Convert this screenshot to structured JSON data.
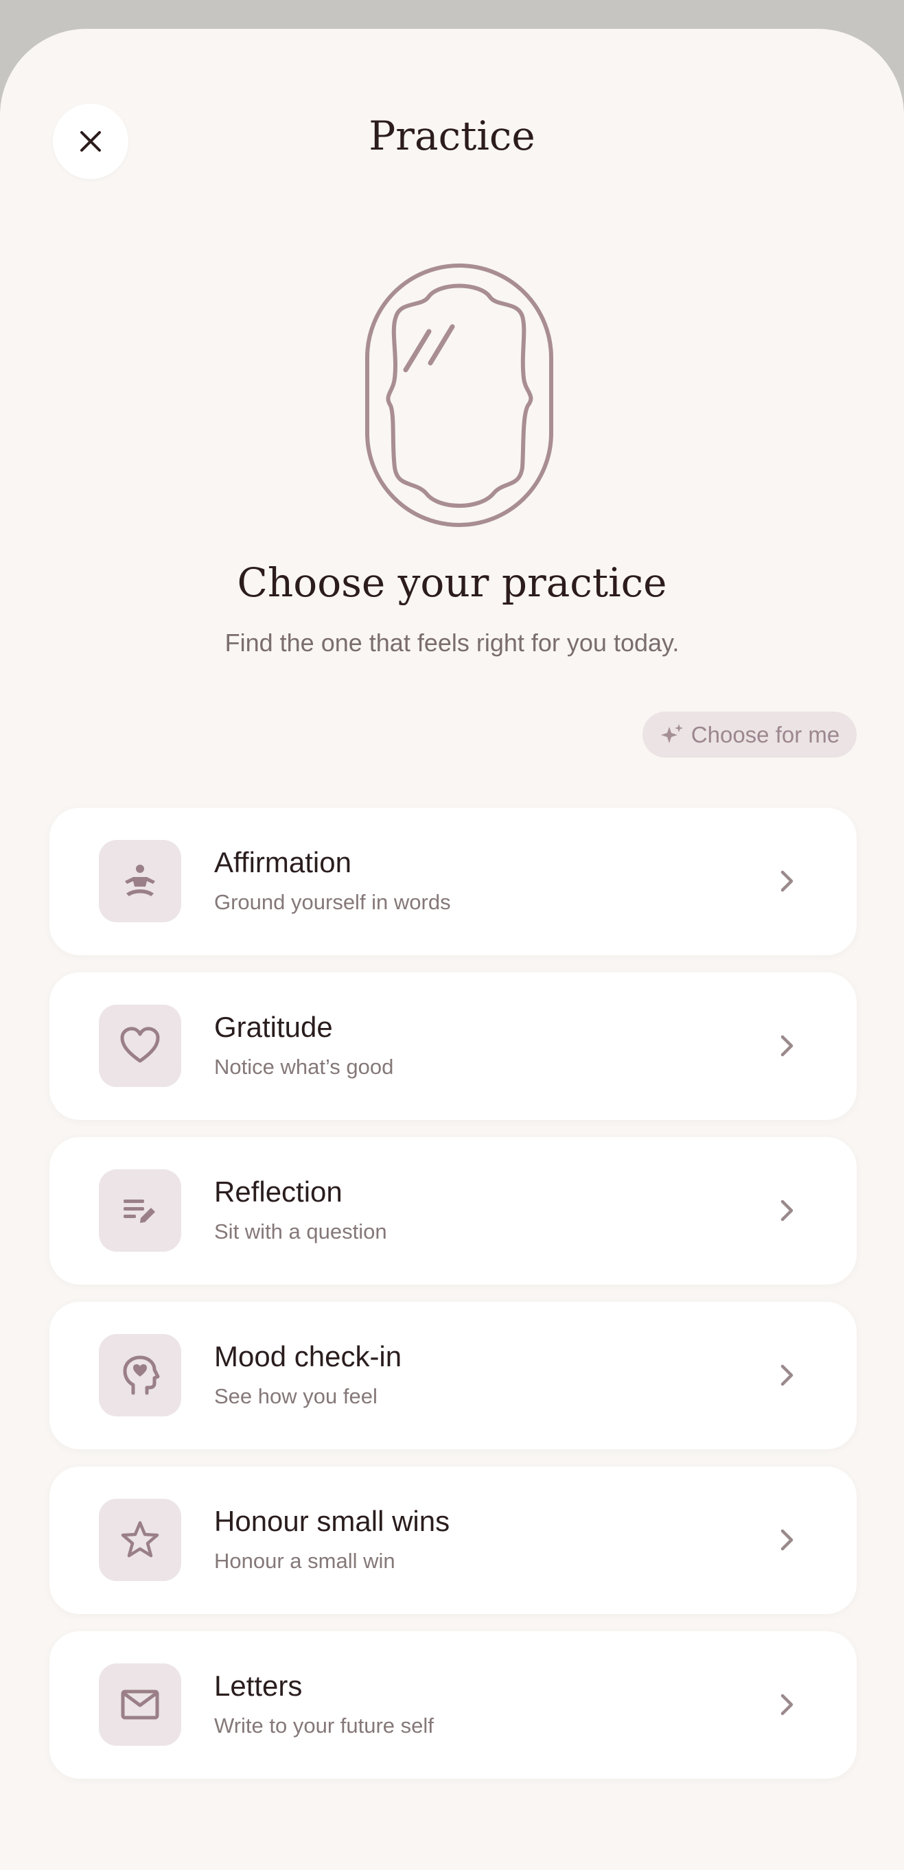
{
  "header": {
    "title": "Practice",
    "close_icon": "close-icon"
  },
  "hero": {
    "illustration": "mirror-illustration"
  },
  "intro": {
    "heading": "Choose your practice",
    "subheading": "Find the one that feels right for you today."
  },
  "choose_for_me": {
    "label": "Choose for me",
    "icon": "sparkle-icon"
  },
  "colors": {
    "background": "#f9f6f3",
    "card": "#ffffff",
    "accent": "#a08890",
    "icon_tile": "#ece4e6",
    "text": "#2a1d1d",
    "muted": "#857878"
  },
  "practices": [
    {
      "title": "Affirmation",
      "subtitle": "Ground yourself in words",
      "icon": "meditation-icon"
    },
    {
      "title": "Gratitude",
      "subtitle": "Notice what’s good",
      "icon": "heart-icon"
    },
    {
      "title": "Reflection",
      "subtitle": "Sit with a question",
      "icon": "edit-note-icon"
    },
    {
      "title": "Mood check-in",
      "subtitle": "See how you feel",
      "icon": "head-heart-icon"
    },
    {
      "title": "Honour small wins",
      "subtitle": "Honour a small win",
      "icon": "star-icon"
    },
    {
      "title": "Letters",
      "subtitle": "Write to your future self",
      "icon": "mail-icon"
    }
  ]
}
